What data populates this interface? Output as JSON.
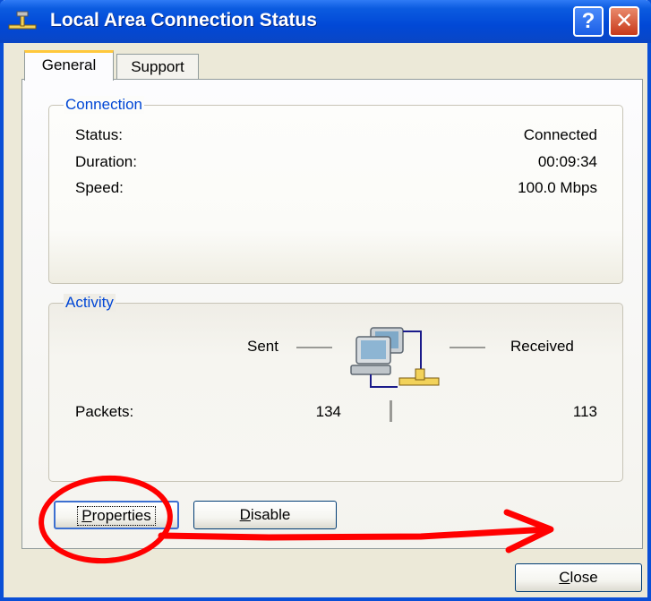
{
  "window": {
    "title": "Local Area Connection Status",
    "help_label": "?",
    "close_label": "✕"
  },
  "tabs": [
    {
      "label": "General",
      "active": true
    },
    {
      "label": "Support",
      "active": false
    }
  ],
  "connection": {
    "legend": "Connection",
    "rows": [
      {
        "label": "Status:",
        "value": "Connected"
      },
      {
        "label": "Duration:",
        "value": "00:09:34"
      },
      {
        "label": "Speed:",
        "value": "100.0 Mbps"
      }
    ]
  },
  "activity": {
    "legend": "Activity",
    "sent_label": "Sent",
    "received_label": "Received",
    "packets_label": "Packets:",
    "packets_sent": "134",
    "packets_received": "113"
  },
  "buttons": {
    "properties_first": "P",
    "properties_rest": "roperties",
    "disable_first": "D",
    "disable_rest": "isable",
    "close_first": "C",
    "close_rest": "lose"
  },
  "colors": {
    "titlebar": "#0148d6",
    "legend_text": "#0046d5",
    "annotation_red": "#ff0000"
  },
  "icons": {
    "title": "network-connection-icon",
    "activity": "network-computers-icon"
  }
}
